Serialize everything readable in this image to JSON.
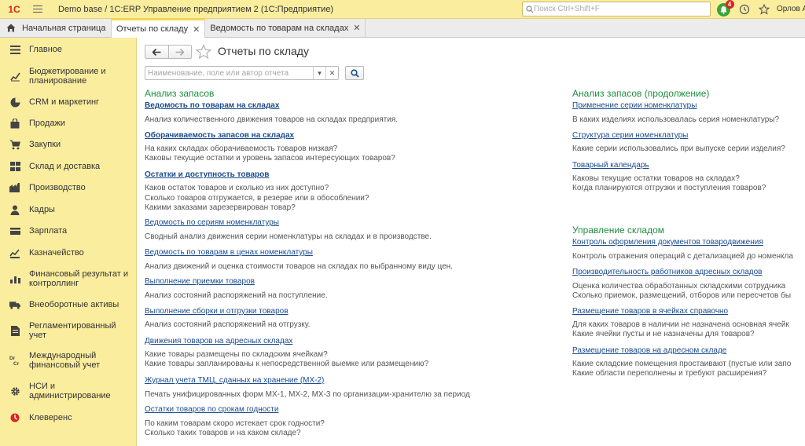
{
  "titlebar": {
    "logo": "1С",
    "title": "Demo base / 1C:ERP Управление предприятием 2  (1С:Предприятие)",
    "search_placeholder": "Поиск Ctrl+Shift+F",
    "notif_count": "4",
    "user": "Орлов Ал"
  },
  "tabs": [
    {
      "label": "Начальная страница"
    },
    {
      "label": "Отчеты по складу"
    },
    {
      "label": "Ведомость по товарам на складах"
    }
  ],
  "sidebar": {
    "items": [
      {
        "label": "Главное",
        "icon": "menu-icon"
      },
      {
        "label": "Бюджетирование и планирование",
        "icon": "chart-icon"
      },
      {
        "label": "CRM и маркетинг",
        "icon": "pie-icon"
      },
      {
        "label": "Продажи",
        "icon": "bag-icon"
      },
      {
        "label": "Закупки",
        "icon": "cart-icon"
      },
      {
        "label": "Склад и доставка",
        "icon": "warehouse-icon"
      },
      {
        "label": "Производство",
        "icon": "factory-icon"
      },
      {
        "label": "Кадры",
        "icon": "person-icon"
      },
      {
        "label": "Зарплата",
        "icon": "wallet-icon"
      },
      {
        "label": "Казначейство",
        "icon": "treasury-icon"
      },
      {
        "label": "Финансовый результат и контроллинг",
        "icon": "bar-chart-icon"
      },
      {
        "label": "Внеоборотные активы",
        "icon": "truck-icon"
      },
      {
        "label": "Регламентированный учет",
        "icon": "document-icon"
      },
      {
        "label": "Международный финансовый учет",
        "icon": "dr-cr-icon"
      },
      {
        "label": "НСИ и администрирование",
        "icon": "gear-icon"
      },
      {
        "label": "Клеверенс",
        "icon": "cleverence-icon"
      }
    ]
  },
  "page": {
    "title": "Отчеты по складу",
    "filter_placeholder": "Наименование, поле или автор отчета"
  },
  "left": {
    "title": "Анализ запасов",
    "reports": [
      {
        "name": "Ведомость по товарам на складах",
        "desc": [
          "Анализ количественного движения товаров на складах предприятия."
        ]
      },
      {
        "name": "Оборачиваемость запасов на складах",
        "desc": [
          "На каких складах оборачиваемость товаров низкая?",
          "Каковы текущие остатки и уровень запасов интересующих товаров?"
        ]
      },
      {
        "name": "Остатки и доступность товаров",
        "desc": [
          "Каков остаток товаров и сколько из них доступно?",
          "Сколько товаров отгружается, в резерве или в обособлении?",
          "Какими заказами зарезервирован товар?"
        ]
      },
      {
        "name": "Ведомость по сериям номенклатуры",
        "desc": [
          "Сводный анализ движения серии номенклатуры на складах и в производстве."
        ]
      },
      {
        "name": "Ведомость по товарам в ценах номенклатуры",
        "desc": [
          "Анализ движений и оценка стоимости товаров на складах по выбранному виду цен."
        ]
      },
      {
        "name": "Выполнение приемки товаров",
        "desc": [
          "Анализ состояний распоряжений на поступление."
        ]
      },
      {
        "name": "Выполнение сборки и отгрузки товаров",
        "desc": [
          "Анализ состояний распоряжений на отгрузку."
        ]
      },
      {
        "name": "Движения товаров на адресных складах",
        "desc": [
          "Какие товары размещены по складским ячейкам?",
          "Какие товары запланированы к непосредственной выемке или размещению?"
        ]
      },
      {
        "name": "Журнал учета ТМЦ, сданных на хранение (МХ-2)",
        "desc": [
          "Печать унифицированных форм МХ-1, МХ-2, МХ-3 по организации-хранителю за период"
        ]
      },
      {
        "name": "Остатки товаров по срокам годности",
        "desc": [
          "По каким товарам скоро истекает срок годности?",
          "Сколько таких товаров и на каком складе?"
        ]
      }
    ]
  },
  "right": {
    "title": "Анализ запасов (продолжение)",
    "reports": [
      {
        "name": "Применение серии номенклатуры",
        "desc": [
          "В каких изделиях использовалась серия номенклатуры?"
        ]
      },
      {
        "name": "Структура серии номенклатуры",
        "desc": [
          "Какие серии использовались при выпуске серии изделия?"
        ]
      },
      {
        "name": "Товарный календарь",
        "desc": [
          "Каковы текущие остатки товаров на складах?",
          "Когда планируются отгрузки и поступления товаров?"
        ]
      }
    ],
    "title2": "Управление складом",
    "reports2": [
      {
        "name": "Контроль оформления документов товародвижения",
        "desc": [
          "Контроль отражения операций с детализацией до номенкла"
        ]
      },
      {
        "name": "Производительность работников адресных складов",
        "desc": [
          "Оценка количества обработанных складскими сотрудника",
          "Сколько приемок, размещений, отборов или пересчетов бы"
        ]
      },
      {
        "name": "Размещение товаров в ячейках справочно",
        "desc": [
          "Для каких товаров в наличии не назначена основная ячейк",
          "Какие ячейки пусты и не назначены для товаров?"
        ]
      },
      {
        "name": "Размещение товаров на адресном складе",
        "desc": [
          "Какие складские помещения простаивают (пустые или запо",
          "Какие области переполнены и требуют расширения?"
        ]
      }
    ]
  }
}
